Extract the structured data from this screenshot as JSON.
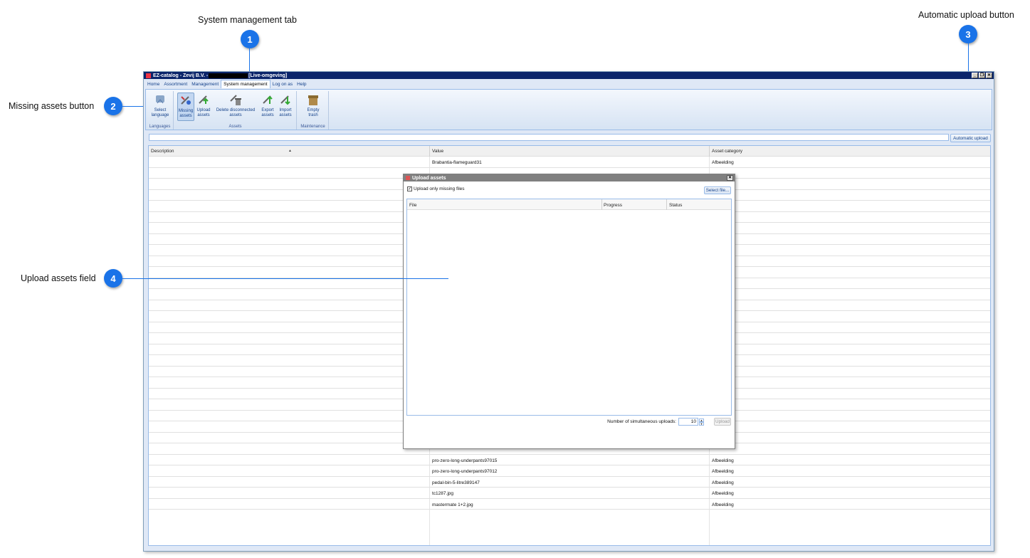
{
  "callouts": [
    {
      "number": "1",
      "label": "System management tab"
    },
    {
      "number": "2",
      "label": "Missing assets button"
    },
    {
      "number": "3",
      "label": "Automatic upload button"
    },
    {
      "number": "4",
      "label": "Upload assets field"
    }
  ],
  "window": {
    "title_prefix": "EZ-catalog - Zevij B.V. -",
    "title_suffix": "[Live-omgeving]",
    "controls": [
      "_",
      "❐",
      "✕"
    ]
  },
  "menu": {
    "tabs": [
      "Home",
      "Assortment",
      "Management",
      "System management",
      "Log on as",
      "Help"
    ],
    "active_tab": "System management"
  },
  "ribbon": {
    "groups": [
      {
        "label": "Languages",
        "buttons": [
          {
            "label": "Select language",
            "icon": "language-icon"
          }
        ]
      },
      {
        "label": "Assets",
        "buttons": [
          {
            "label": "Missing assets",
            "icon": "missing-assets-icon"
          },
          {
            "label": "Upload assets",
            "icon": "upload-assets-icon"
          },
          {
            "label": "Delete disconnected assets",
            "icon": "delete-assets-icon"
          },
          {
            "label": "Export assets",
            "icon": "export-icon"
          },
          {
            "label": "Import assets",
            "icon": "import-icon"
          }
        ]
      },
      {
        "label": "Maintenance",
        "buttons": [
          {
            "label": "Empty trash",
            "icon": "trash-icon"
          }
        ]
      }
    ]
  },
  "toolbar": {
    "search_value": "",
    "automatic_upload_label": "Automatic upload"
  },
  "grid": {
    "columns": [
      "Description",
      "Value",
      "Asset category"
    ],
    "rows_top": [
      {
        "description": "",
        "value": "Brabantia-flameguard31",
        "category": "Afbeelding"
      }
    ],
    "rows_bottom": [
      {
        "description": "",
        "value": "pro-zero-long-underpants97015",
        "category": "Afbeelding"
      },
      {
        "description": "",
        "value": "pro-zero-long-underpants97012",
        "category": "Afbeelding"
      },
      {
        "description": "",
        "value": "pedal-bin-5-litre389147",
        "category": "Afbeelding"
      },
      {
        "description": "",
        "value": "tc1287.jpg",
        "category": "Afbeelding"
      },
      {
        "description": "",
        "value": "mastermate 1+2.jpg",
        "category": "Afbeelding"
      }
    ]
  },
  "upload_dialog": {
    "title": "Upload assets",
    "close": "✕",
    "only_missing_label": "Upload only missing files",
    "only_missing_checked": true,
    "select_file_label": "Select file...",
    "columns": [
      "File",
      "Progress",
      "Status"
    ],
    "simultaneous_label": "Number of simultaneous uploads:",
    "simultaneous_value": "10",
    "upload_label": "Upload"
  }
}
